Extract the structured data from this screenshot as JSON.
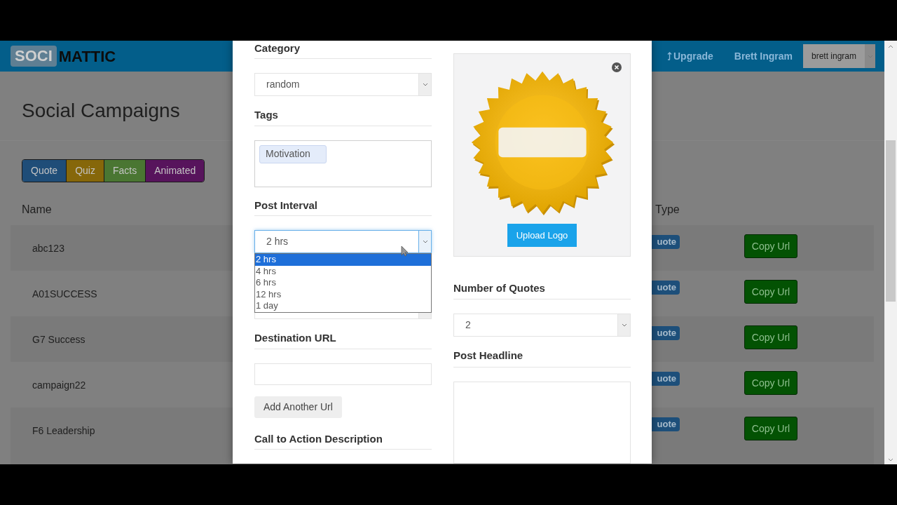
{
  "navbar": {
    "logo_boxed": "SOCI",
    "logo_rest": "MATTIC",
    "upgrade_link": "Upgrade",
    "user_link": "Brett Ingram",
    "user_select": "brett ingram"
  },
  "page": {
    "title": "Social Campaigns",
    "type_filters": [
      {
        "label": "Quote",
        "color": "#1f4d78"
      },
      {
        "label": "Quiz",
        "color": "#86670a"
      },
      {
        "label": "Facts",
        "color": "#4a7632"
      },
      {
        "label": "Animated",
        "color": "#57145c"
      }
    ],
    "table": {
      "columns": [
        "Name",
        "Type"
      ],
      "rows": [
        {
          "name": "abc123",
          "type": "uote",
          "action": "Copy Url"
        },
        {
          "name": "A01SUCCESS",
          "type": "uote",
          "action": "Copy Url"
        },
        {
          "name": "G7 Success",
          "type": "uote",
          "action": "Copy Url"
        },
        {
          "name": "campaign22",
          "type": "uote",
          "action": "Copy Url"
        },
        {
          "name": "F6 Leadership",
          "type": "uote",
          "action": "Copy Url"
        }
      ]
    }
  },
  "modal": {
    "left_column": [
      {
        "kind": "heading",
        "text": "Category"
      },
      {
        "kind": "select",
        "value": "random",
        "expanded": false
      },
      {
        "kind": "heading",
        "text": "Tags"
      },
      {
        "kind": "tags",
        "tags": [
          "Motivation"
        ]
      },
      {
        "kind": "heading",
        "text": "Post Interval"
      },
      {
        "kind": "select",
        "value": "2 hrs",
        "expanded": true,
        "options": [
          {
            "label": "2 hrs",
            "selected": true
          },
          {
            "label": "4 hrs",
            "selected": false
          },
          {
            "label": "6 hrs",
            "selected": false
          },
          {
            "label": "12 hrs",
            "selected": false
          },
          {
            "label": "1 day",
            "selected": false
          }
        ]
      },
      {
        "kind": "select",
        "expanded": false
      },
      {
        "kind": "heading",
        "text": "Destination URL"
      },
      {
        "kind": "input"
      },
      {
        "kind": "button",
        "label": "Add Another Url"
      },
      {
        "kind": "heading",
        "text": "Call to Action Description"
      }
    ],
    "right_column": [
      {
        "kind": "logo",
        "button": "Upload Logo"
      },
      {
        "kind": "heading",
        "text": "Number of Quotes"
      },
      {
        "kind": "select",
        "value": "2",
        "expanded": false
      },
      {
        "kind": "heading",
        "text": "Post Headline"
      },
      {
        "kind": "textarea"
      }
    ]
  }
}
